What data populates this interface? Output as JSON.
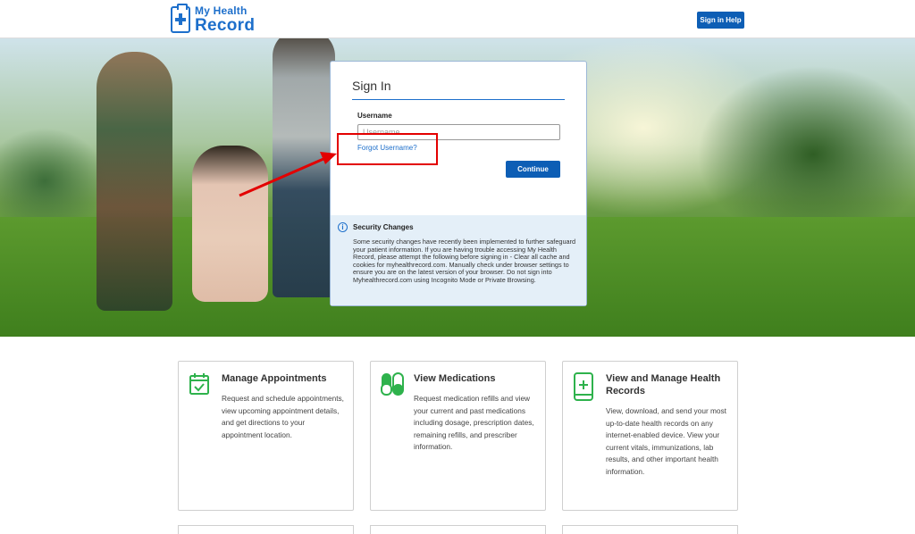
{
  "header": {
    "logo_line1": "My Health",
    "logo_line2": "Record",
    "help_button": "Sign in Help"
  },
  "signin": {
    "title": "Sign In",
    "username_label": "Username",
    "username_placeholder": "Username",
    "username_value": "",
    "forgot_link": "Forgot Username?",
    "continue_button": "Continue"
  },
  "notice": {
    "icon": "info-icon",
    "title": "Security Changes",
    "body": "Some security changes have recently been implemented to further safeguard your patient information. If you are having trouble accessing My Health Record, please attempt the following before signing in - Clear all cache and cookies for myhealthrecord.com. Manually check under browser settings to ensure you are on the latest version of your browser. Do not sign into Myhealthrecord.com using Incognito Mode or Private Browsing."
  },
  "features": [
    {
      "icon": "calendar-check-icon",
      "title": "Manage Appointments",
      "description": "Request and schedule appointments, view upcoming appointment details, and get directions to your appointment location."
    },
    {
      "icon": "pill-capsule-icon",
      "title": "View Medications",
      "description": "Request medication refills and view your current and past medications including dosage, prescription dates, remaining refills, and prescriber information."
    },
    {
      "icon": "mobile-health-icon",
      "title": "View and Manage Health Records",
      "description": "View, download, and send your most up-to-date health records on any internet-enabled device. View your current vitals, immunizations, lab results, and other important health information."
    }
  ],
  "colors": {
    "brand_blue": "#1d6fcb",
    "button_blue": "#0d5eb5",
    "feature_green": "#2eb24c",
    "highlight_red": "#e30000"
  }
}
